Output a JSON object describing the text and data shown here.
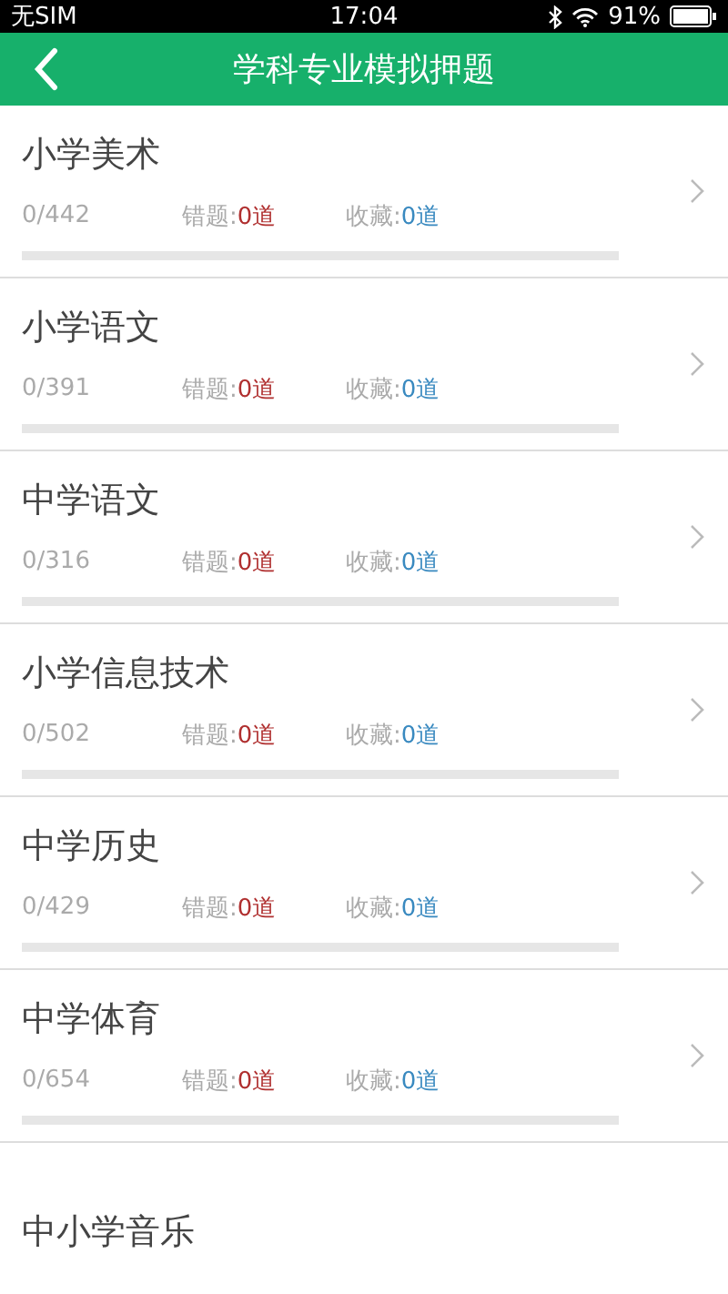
{
  "status_bar": {
    "carrier": "无SIM",
    "time": "17:04",
    "battery": "91%"
  },
  "header": {
    "title": "学科专业模拟押题"
  },
  "subjects": [
    {
      "name": "小学美术",
      "progress": "0/442",
      "wrong_label": "错题:",
      "wrong_count": "0道",
      "fav_label": "收藏:",
      "fav_count": "0道"
    },
    {
      "name": "小学语文",
      "progress": "0/391",
      "wrong_label": "错题:",
      "wrong_count": "0道",
      "fav_label": "收藏:",
      "fav_count": "0道"
    },
    {
      "name": "中学语文",
      "progress": "0/316",
      "wrong_label": "错题:",
      "wrong_count": "0道",
      "fav_label": "收藏:",
      "fav_count": "0道"
    },
    {
      "name": "小学信息技术",
      "progress": "0/502",
      "wrong_label": "错题:",
      "wrong_count": "0道",
      "fav_label": "收藏:",
      "fav_count": "0道"
    },
    {
      "name": "中学历史",
      "progress": "0/429",
      "wrong_label": "错题:",
      "wrong_count": "0道",
      "fav_label": "收藏:",
      "fav_count": "0道"
    },
    {
      "name": "中学体育",
      "progress": "0/654",
      "wrong_label": "错题:",
      "wrong_count": "0道",
      "fav_label": "收藏:",
      "fav_count": "0道"
    },
    {
      "name": "中小学音乐"
    }
  ]
}
